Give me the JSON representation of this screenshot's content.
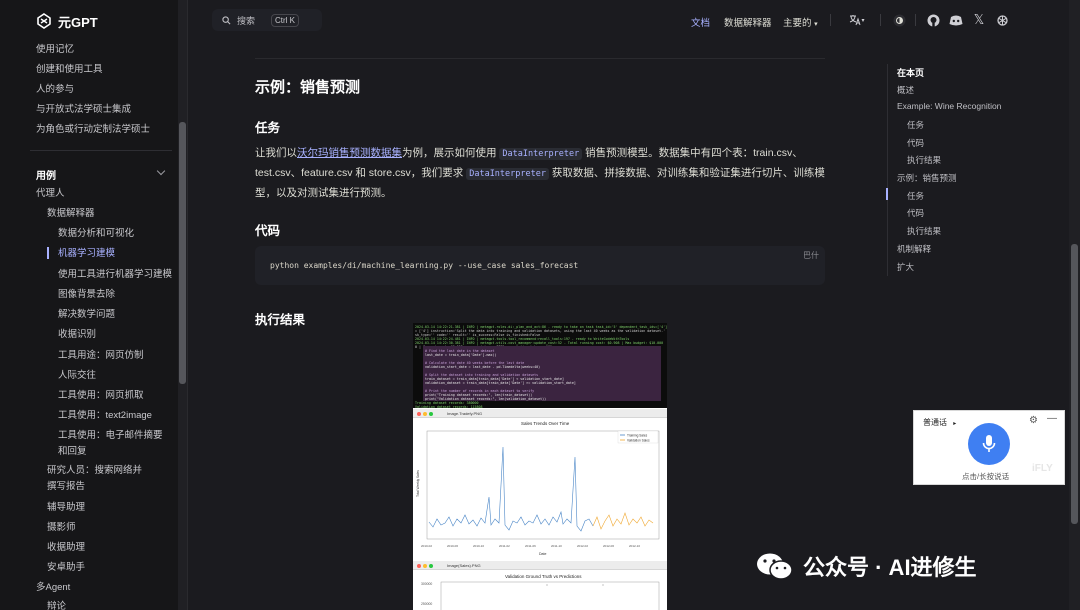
{
  "brand": {
    "name": "元GPT"
  },
  "topbar": {
    "search_label": "搜索",
    "search_shortcut": "Ctrl K",
    "nav": [
      {
        "label": "文档",
        "active": true
      },
      {
        "label": "数据解释器",
        "active": false
      },
      {
        "label": "主要的",
        "active": false
      }
    ]
  },
  "sidebar": {
    "items_top": [
      "使用记忆",
      "创建和使用工具",
      "人的参与",
      "与开放式法学硕士集成",
      "为角色或行动定制法学硕士"
    ],
    "section_label": "用例",
    "agent_label": "代理人",
    "di_label": "数据解释器",
    "di_items": [
      "数据分析和可视化",
      "机器学习建模",
      "使用工具进行机器学习建模",
      "图像背景去除",
      "解决数学问题",
      "收据识别",
      "工具用途：网页仿制",
      "人际交往",
      "工具使用：网页抓取",
      "工具使用：text2image",
      "工具使用：电子邮件摘要和回复"
    ],
    "other_items": [
      "研究人员：搜索网络并撰写报告",
      "辅导助理",
      "摄影师",
      "收据助理",
      "安卓助手"
    ],
    "multi_agent": "多Agent",
    "debate": "辩论"
  },
  "content": {
    "title": "示例：销售预测",
    "task_heading": "任务",
    "task_para_1": "让我们以",
    "task_link": "沃尔玛销售预测数据集",
    "task_para_2": "为例，展示如何使用",
    "task_code_1": "DataInterpreter",
    "task_para_3": "销售预测模型。数据集中有四个表：train.csv、test.csv、feature.csv 和 store.csv，我们要求",
    "task_code_2": "DataInterpreter",
    "task_para_4": "获取数据、拼接数据、对训练集和验证集进行切片、训练模型，以及对测试集进行预测。",
    "code_heading": "代码",
    "code_line": "python examples/di/machine_learning.py --use_case sales_forecast",
    "code_lang": "巴什",
    "result_heading": "执行结果"
  },
  "screenshot": {
    "win1_name": "Image.Tradefy.PNG",
    "win2_name": "Image(Sales).PNG",
    "plot1_title": "Sales Trends Over Time",
    "plot1_legend": [
      "Training Sales",
      "Validation Sales"
    ],
    "plot1_xlabel": "Date",
    "plot1_ylabel": "Total Weekly Sales",
    "plot1_xticks": [
      "2010-02",
      "2010-06",
      "2010-10",
      "2011-02",
      "2011-06",
      "2011-10",
      "2012-02",
      "2012-06",
      "2012-10"
    ],
    "plot2_title": "Validation Ground Truth vs Predictions",
    "plot2_yticks": [
      "300000",
      "250000"
    ]
  },
  "toc": {
    "title": "在本页",
    "items": [
      {
        "label": "概述",
        "indent": false
      },
      {
        "label": "Example: Wine Recognition",
        "indent": false
      },
      {
        "label": "任务",
        "indent": true
      },
      {
        "label": "代码",
        "indent": true
      },
      {
        "label": "执行结果",
        "indent": true
      },
      {
        "label": "示例：销售预测",
        "indent": false
      },
      {
        "label": "任务",
        "indent": true
      },
      {
        "label": "代码",
        "indent": true
      },
      {
        "label": "执行结果",
        "indent": true
      },
      {
        "label": "机制解释",
        "indent": false
      },
      {
        "label": "扩大",
        "indent": false
      }
    ]
  },
  "voice_widget": {
    "mode": "普通话",
    "hint": "点击/长按说话",
    "watermark": "iFLY"
  },
  "watermark": {
    "text": "公众号 · AI进修生"
  },
  "colors": {
    "accent": "#a8b1ff",
    "background": "#1b1b1f",
    "sidebar": "#161618",
    "mic": "#3f7ff2",
    "train_series": "#4a86c7",
    "valid_series": "#f0a830"
  }
}
